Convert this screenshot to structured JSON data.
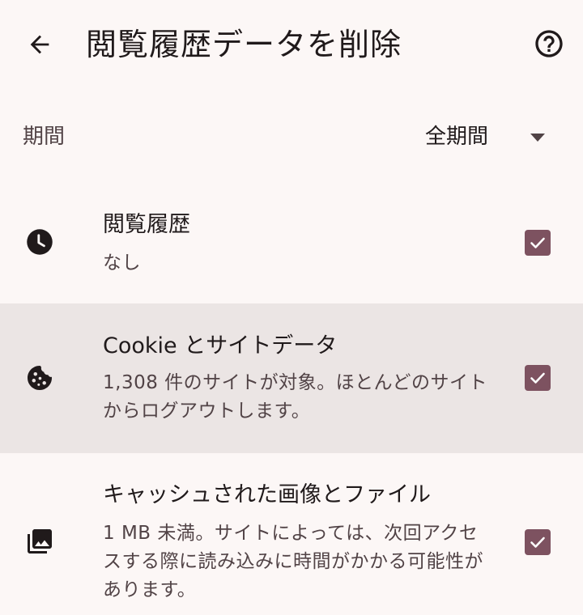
{
  "header": {
    "title": "閲覧履歴データを削除",
    "back_icon": "arrow-back-icon",
    "help_icon": "help-circle-icon"
  },
  "period": {
    "label": "期間",
    "value": "全期間",
    "dropdown_icon": "arrow-drop-down-icon"
  },
  "options": [
    {
      "icon": "clock-icon",
      "title": "閲覧履歴",
      "subtitle": "なし",
      "checked": true
    },
    {
      "icon": "cookie-icon",
      "title": "Cookie とサイトデータ",
      "subtitle": "1,308 件のサイトが対象。ほとんどのサイトからログアウトします。",
      "checked": true,
      "highlighted": true
    },
    {
      "icon": "photo-library-icon",
      "title": "キャッシュされた画像とファイル",
      "subtitle": "1 MB 未満。サイトによっては、次回アクセスする際に読み込みに時間がかかる可能性があります。",
      "checked": true
    }
  ],
  "colors": {
    "background": "#fcf7f6",
    "highlight": "#ebe5e4",
    "checkbox": "#7d5260",
    "text_primary": "#201a1b",
    "text_secondary": "#514346"
  }
}
